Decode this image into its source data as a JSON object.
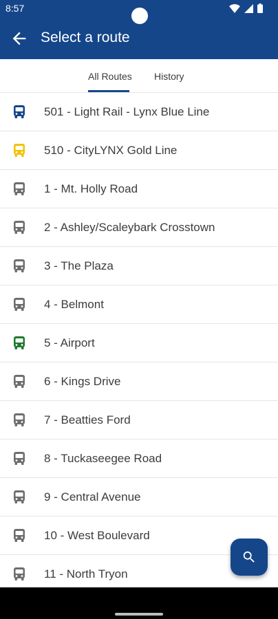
{
  "status_bar": {
    "time": "8:57",
    "icons": [
      "wifi-icon",
      "signal-icon",
      "battery-icon"
    ]
  },
  "app_bar": {
    "title": "Select a route",
    "back_icon": "arrow-back-icon"
  },
  "tabs": [
    {
      "label": "All Routes",
      "selected": true
    },
    {
      "label": "History",
      "selected": false
    }
  ],
  "routes": [
    {
      "label": "501 - Light Rail - Lynx Blue Line",
      "icon": "bus-icon",
      "color": "#15468a"
    },
    {
      "label": "510 - CityLYNX Gold Line",
      "icon": "bus-icon",
      "color": "#f2c200"
    },
    {
      "label": "1 - Mt. Holly Road",
      "icon": "bus-icon",
      "color": "#6e6e6e"
    },
    {
      "label": "2 - Ashley/Scaleybark Crosstown",
      "icon": "bus-icon",
      "color": "#6e6e6e"
    },
    {
      "label": "3 - The Plaza",
      "icon": "bus-icon",
      "color": "#6e6e6e"
    },
    {
      "label": "4 - Belmont",
      "icon": "bus-icon",
      "color": "#6e6e6e"
    },
    {
      "label": "5 - Airport",
      "icon": "bus-icon",
      "color": "#1e7a2c"
    },
    {
      "label": "6 - Kings Drive",
      "icon": "bus-icon",
      "color": "#6e6e6e"
    },
    {
      "label": "7 - Beatties Ford",
      "icon": "bus-icon",
      "color": "#6e6e6e"
    },
    {
      "label": "8 - Tuckaseegee Road",
      "icon": "bus-icon",
      "color": "#6e6e6e"
    },
    {
      "label": "9 - Central Avenue",
      "icon": "bus-icon",
      "color": "#6e6e6e"
    },
    {
      "label": "10 - West Boulevard",
      "icon": "bus-icon",
      "color": "#6e6e6e"
    },
    {
      "label": "11 - North Tryon",
      "icon": "bus-icon",
      "color": "#6e6e6e"
    }
  ],
  "fab": {
    "icon": "search-icon"
  },
  "colors": {
    "primary": "#15468a",
    "divider": "#e5e5e5"
  }
}
